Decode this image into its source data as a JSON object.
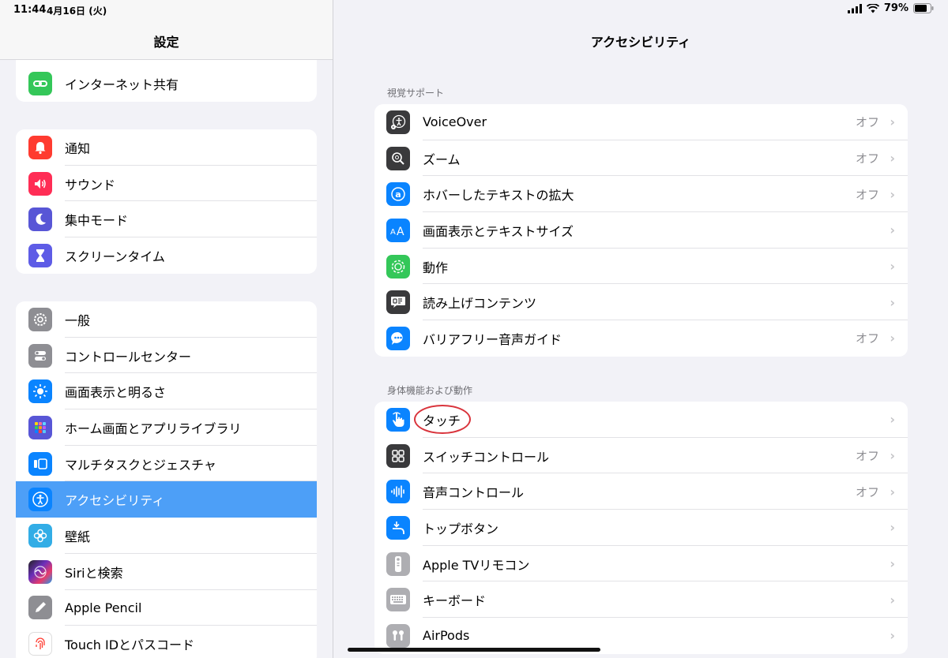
{
  "status": {
    "time": "11:44",
    "date": "4月16日 (火)",
    "battery": "79%"
  },
  "sidebar": {
    "title": "設定",
    "group0": [
      {
        "label": "インターネット共有",
        "icon": "link-icon",
        "color": "#34c759"
      }
    ],
    "group1": [
      {
        "label": "通知",
        "icon": "bell-icon",
        "color": "#ff3b30"
      },
      {
        "label": "サウンド",
        "icon": "speaker-icon",
        "color": "#ff2d55"
      },
      {
        "label": "集中モード",
        "icon": "moon-icon",
        "color": "#5856d6"
      },
      {
        "label": "スクリーンタイム",
        "icon": "hourglass-icon",
        "color": "#5e5ce6"
      }
    ],
    "group2": [
      {
        "label": "一般",
        "icon": "gear-icon",
        "color": "#8e8e93"
      },
      {
        "label": "コントロールセンター",
        "icon": "toggles-icon",
        "color": "#8e8e93"
      },
      {
        "label": "画面表示と明るさ",
        "icon": "sun-icon",
        "color": "#0a84ff"
      },
      {
        "label": "ホーム画面とアプリライブラリ",
        "icon": "app-grid-icon",
        "color": "#5856d6"
      },
      {
        "label": "マルチタスクとジェスチャ",
        "icon": "multitask-icon",
        "color": "#0a84ff"
      },
      {
        "label": "アクセシビリティ",
        "icon": "accessibility-icon",
        "color": "#0a84ff",
        "selected": true
      },
      {
        "label": "壁紙",
        "icon": "flower-icon",
        "color": "#32ade6"
      },
      {
        "label": "Siriと検索",
        "icon": "siri-icon",
        "color": "#6b2fbb"
      },
      {
        "label": "Apple Pencil",
        "icon": "pencil-icon",
        "color": "#8e8e93"
      },
      {
        "label": "Touch IDとパスコード",
        "icon": "fingerprint-icon",
        "color": "#ff3b30"
      }
    ]
  },
  "detail": {
    "title": "アクセシビリティ",
    "section1": {
      "header": "視覚サポート",
      "rows": [
        {
          "label": "VoiceOver",
          "value": "オフ",
          "icon": "voiceover-icon"
        },
        {
          "label": "ズーム",
          "value": "オフ",
          "icon": "zoom-icon"
        },
        {
          "label": "ホバーしたテキストの拡大",
          "value": "オフ",
          "icon": "hover-text-icon"
        },
        {
          "label": "画面表示とテキストサイズ",
          "value": "",
          "icon": "text-size-icon"
        },
        {
          "label": "動作",
          "value": "",
          "icon": "motion-icon"
        },
        {
          "label": "読み上げコンテンツ",
          "value": "",
          "icon": "spoken-content-icon"
        },
        {
          "label": "バリアフリー音声ガイド",
          "value": "オフ",
          "icon": "audio-description-icon"
        }
      ]
    },
    "section2": {
      "header": "身体機能および動作",
      "rows": [
        {
          "label": "タッチ",
          "value": "",
          "icon": "touch-hand-icon"
        },
        {
          "label": "スイッチコントロール",
          "value": "オフ",
          "icon": "switch-control-icon"
        },
        {
          "label": "音声コントロール",
          "value": "オフ",
          "icon": "voice-control-icon"
        },
        {
          "label": "トップボタン",
          "value": "",
          "icon": "top-button-icon"
        },
        {
          "label": "Apple TVリモコン",
          "value": "",
          "icon": "remote-icon"
        },
        {
          "label": "キーボード",
          "value": "",
          "icon": "keyboard-icon"
        },
        {
          "label": "AirPods",
          "value": "",
          "icon": "airpods-icon"
        }
      ]
    }
  }
}
